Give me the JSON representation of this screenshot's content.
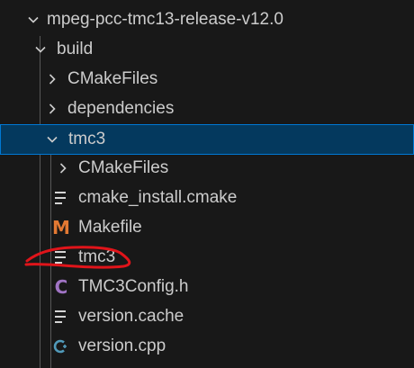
{
  "explorer": {
    "root": {
      "label": "mpeg-pcc-tmc13-release-v12.0",
      "icon": "chevron-down-icon"
    },
    "items": [
      {
        "label": "build",
        "icon": "chevron-down-icon"
      },
      {
        "label": "CMakeFiles",
        "icon": "chevron-right-icon"
      },
      {
        "label": "dependencies",
        "icon": "chevron-right-icon"
      },
      {
        "label": "tmc3",
        "icon": "chevron-down-icon",
        "selected": true
      },
      {
        "label": "CMakeFiles",
        "icon": "chevron-right-icon"
      },
      {
        "label": "cmake_install.cmake",
        "icon": "text-file-icon"
      },
      {
        "label": "Makefile",
        "icon": "makefile-icon",
        "icon_glyph": "M"
      },
      {
        "label": "tmc3",
        "icon": "text-file-icon",
        "annotated": true
      },
      {
        "label": "TMC3Config.h",
        "icon": "c-header-icon",
        "icon_glyph": "C"
      },
      {
        "label": "version.cache",
        "icon": "text-file-icon"
      },
      {
        "label": "version.cpp",
        "icon": "cpp-file-icon",
        "icon_glyph": "C+"
      }
    ]
  },
  "colors": {
    "background": "#181818",
    "selection_background": "#04395e",
    "selection_border": "#0078d4",
    "makefile_icon": "#e37933",
    "c_header_icon": "#a074c4",
    "cpp_icon": "#519aba",
    "annotation_stroke": "#e0141a"
  }
}
